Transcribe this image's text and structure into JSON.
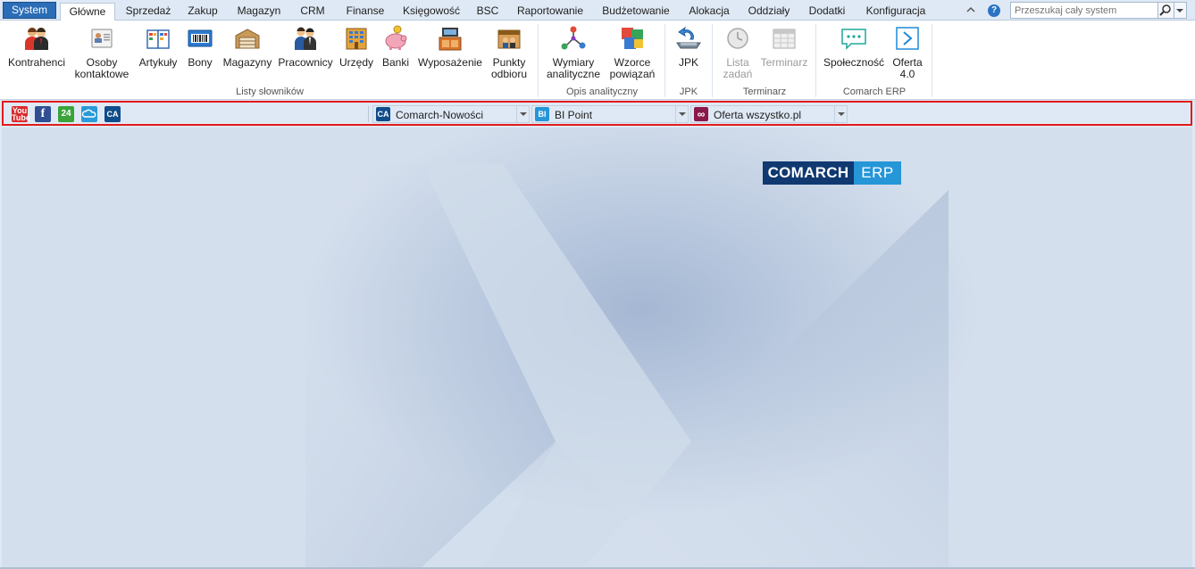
{
  "tabs": {
    "system": "System",
    "items": [
      "Główne",
      "Sprzedaż",
      "Zakup",
      "Magazyn",
      "CRM",
      "Finanse",
      "Księgowość",
      "BSC",
      "Raportowanie",
      "Budżetowanie",
      "Alokacja",
      "Oddziały",
      "Dodatki",
      "Konfiguracja"
    ]
  },
  "search": {
    "placeholder": "Przeszukaj cały system"
  },
  "help": {
    "label": "?"
  },
  "ribbon": {
    "groups": {
      "listy": "Listy słowników",
      "opis": "Opis analityczny",
      "jpk": "JPK",
      "terminarz": "Terminarz",
      "comarch": "Comarch ERP"
    },
    "buttons": {
      "kontrahenci": "Kontrahenci",
      "osoby_1": "Osoby",
      "osoby_2": "kontaktowe",
      "artykuly": "Artykuły",
      "bony": "Bony",
      "magazyny": "Magazyny",
      "pracownicy": "Pracownicy",
      "urzedy": "Urzędy",
      "banki": "Banki",
      "wyposazenie": "Wyposażenie",
      "punkty_1": "Punkty",
      "punkty_2": "odbioru",
      "wymiary_1": "Wymiary",
      "wymiary_2": "analityczne",
      "wzorce_1": "Wzorce",
      "wzorce_2": "powiązań",
      "jpk": "JPK",
      "lista_1": "Lista",
      "lista_2": "zadań",
      "terminarz": "Terminarz",
      "spolecznosc": "Społeczność",
      "oferta_1": "Oferta",
      "oferta_2": "4.0"
    }
  },
  "quickbar": {
    "icons": {
      "youtube_1": "You",
      "youtube_2": "Tube",
      "facebook": "f",
      "p24": "24",
      "ca": "CA"
    },
    "combos": [
      {
        "icon": "CA",
        "label": "Comarch-Nowości"
      },
      {
        "icon": "BI",
        "label": "BI Point"
      },
      {
        "icon": "∞",
        "label": "Oferta wszystko.pl"
      }
    ]
  },
  "logo": {
    "part1": "COMARCH",
    "part2": "ERP"
  },
  "colors": {
    "accent": "#2b6db6",
    "highlight": "#e21b1b",
    "logo_dark": "#0f3970",
    "logo_light": "#2596d8"
  }
}
